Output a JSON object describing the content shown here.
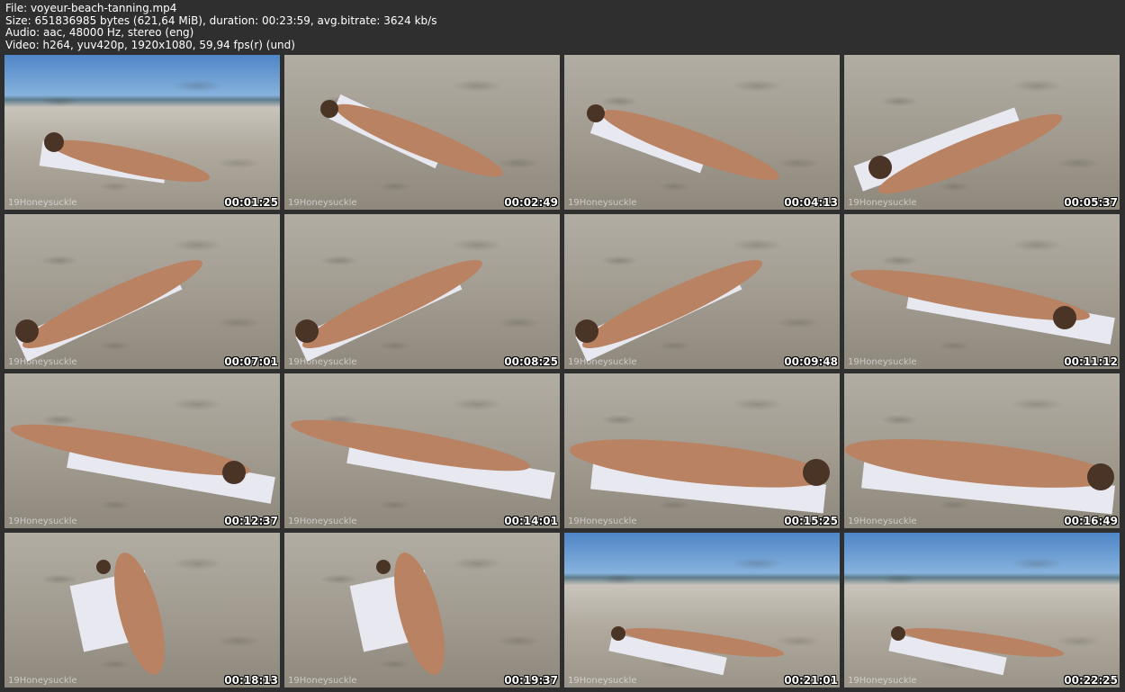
{
  "header": {
    "file": "File: voyeur-beach-tanning.mp4",
    "size": "Size: 651836985 bytes (621,64 MiB), duration: 00:23:59, avg.bitrate: 3624 kb/s",
    "audio": "Audio: aac, 48000 Hz, stereo (eng)",
    "video": "Video: h264, yuv420p, 1920x1080, 59,94 fps(r) (und)"
  },
  "thumbnails": [
    {
      "timestamp": "00:01:25",
      "watermark": "19Honeysuckle"
    },
    {
      "timestamp": "00:02:49",
      "watermark": "19Honeysuckle"
    },
    {
      "timestamp": "00:04:13",
      "watermark": "19Honeysuckle"
    },
    {
      "timestamp": "00:05:37",
      "watermark": "19Honeysuckle"
    },
    {
      "timestamp": "00:07:01",
      "watermark": "19Honeysuckle"
    },
    {
      "timestamp": "00:08:25",
      "watermark": "19Honeysuckle"
    },
    {
      "timestamp": "00:09:48",
      "watermark": "19Honeysuckle"
    },
    {
      "timestamp": "00:11:12",
      "watermark": "19Honeysuckle"
    },
    {
      "timestamp": "00:12:37",
      "watermark": "19Honeysuckle"
    },
    {
      "timestamp": "00:14:01",
      "watermark": "19Honeysuckle"
    },
    {
      "timestamp": "00:15:25",
      "watermark": "19Honeysuckle"
    },
    {
      "timestamp": "00:16:49",
      "watermark": "19Honeysuckle"
    },
    {
      "timestamp": "00:18:13",
      "watermark": "19Honeysuckle"
    },
    {
      "timestamp": "00:19:37",
      "watermark": "19Honeysuckle"
    },
    {
      "timestamp": "00:21:01",
      "watermark": "19Honeysuckle"
    },
    {
      "timestamp": "00:22:25",
      "watermark": "19Honeysuckle"
    }
  ]
}
